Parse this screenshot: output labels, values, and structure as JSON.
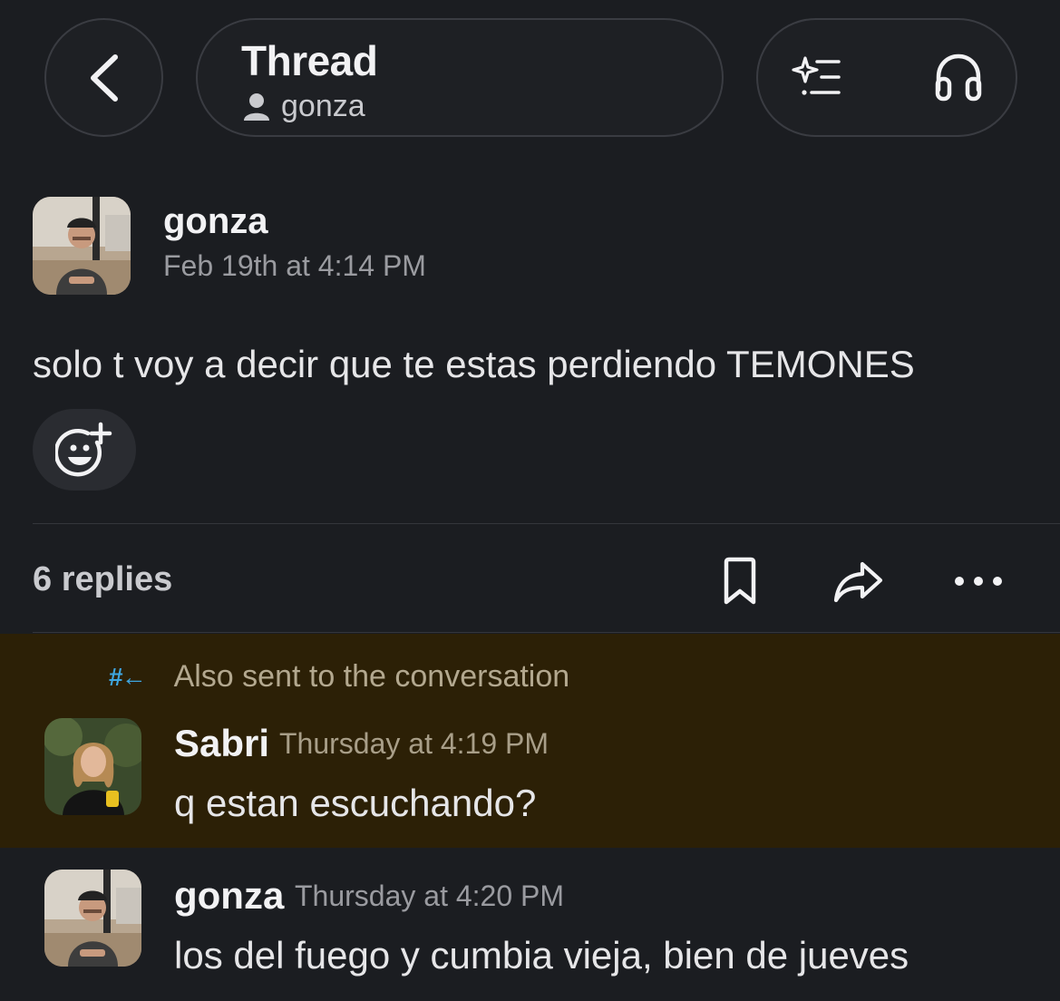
{
  "header": {
    "title": "Thread",
    "subtitle_user": "gonza"
  },
  "parent_message": {
    "author": "gonza",
    "timestamp": "Feb 19th at 4:14 PM",
    "text": "solo t voy a decir que te estas perdiendo TEMONES"
  },
  "replies_bar": {
    "count_label": "6 replies"
  },
  "replies": [
    {
      "notice": "Also sent to the conversation",
      "author": "Sabri",
      "timestamp": "Thursday at 4:19 PM",
      "text": "q estan escuchando?"
    },
    {
      "author": "gonza",
      "timestamp": "Thursday at 4:20 PM",
      "text": "los del fuego y cumbia vieja, bien de jueves"
    }
  ],
  "colors": {
    "background": "#1b1d21",
    "highlight": "#2c2006",
    "hash_accent": "#3ea6e0"
  }
}
